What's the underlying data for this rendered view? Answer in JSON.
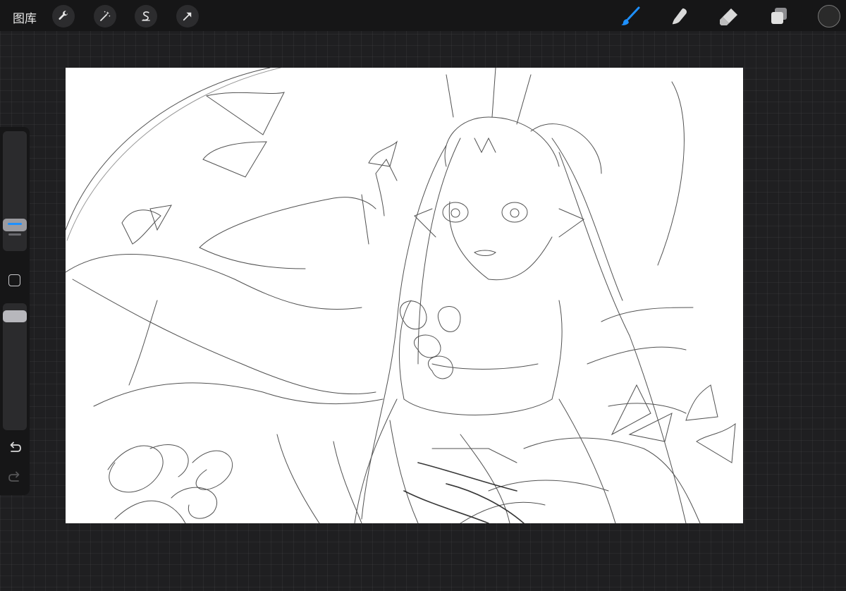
{
  "toolbar": {
    "gallery_label": "图库",
    "left_tools": [
      "wrench-icon",
      "magic-wand-icon",
      "selection-icon",
      "transform-arrow-icon"
    ],
    "right_tools": [
      "brush-icon",
      "smudge-icon",
      "eraser-icon",
      "layers-icon"
    ],
    "active_tool": "brush",
    "accent_color": "#1e90ff",
    "current_color": "#2a2a2a"
  },
  "sidebar": {
    "brush_size_level": 0.76,
    "brush_opacity_level": 0.06,
    "controls": [
      "modify-button",
      "undo-arrow-icon",
      "redo-arrow-icon"
    ]
  },
  "canvas": {
    "background": "#ffffff",
    "content": "pencil sketch"
  }
}
